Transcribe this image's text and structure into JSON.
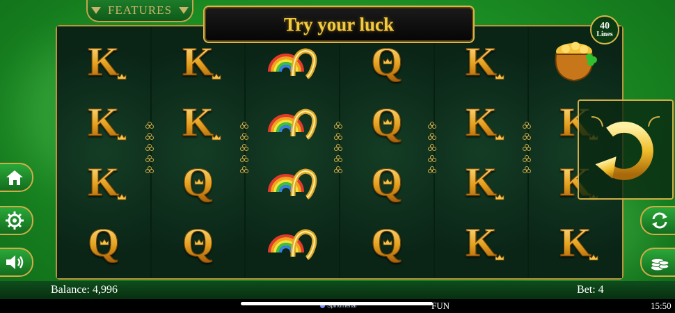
{
  "top": {
    "features_label": "FEATURES",
    "title": "Try your luck",
    "lines_count": "40",
    "lines_label": "Lines"
  },
  "reels": [
    [
      "K",
      "K",
      "K",
      "Q"
    ],
    [
      "K",
      "K",
      "Q",
      "Q"
    ],
    [
      "rainbow-horseshoe",
      "rainbow-horseshoe",
      "rainbow-horseshoe",
      "rainbow-horseshoe"
    ],
    [
      "Q",
      "Q",
      "Q",
      "Q"
    ],
    [
      "K",
      "K",
      "K",
      "K"
    ],
    [
      "pot-of-gold",
      "K",
      "K",
      "K"
    ]
  ],
  "left_buttons": [
    "home-icon",
    "settings-icon",
    "sound-icon"
  ],
  "right_buttons": [
    "autoplay-icon",
    "coins-icon"
  ],
  "bottom": {
    "balance_label": "Balance: 4,996",
    "bet_label": "Bet: 4"
  },
  "system": {
    "mode": "FUN",
    "time": "15:50",
    "brand": "Spinomenal"
  },
  "colors": {
    "gold": "#d8b64c",
    "green": "#1c8f24",
    "reel_bg": "#0c2a18"
  }
}
